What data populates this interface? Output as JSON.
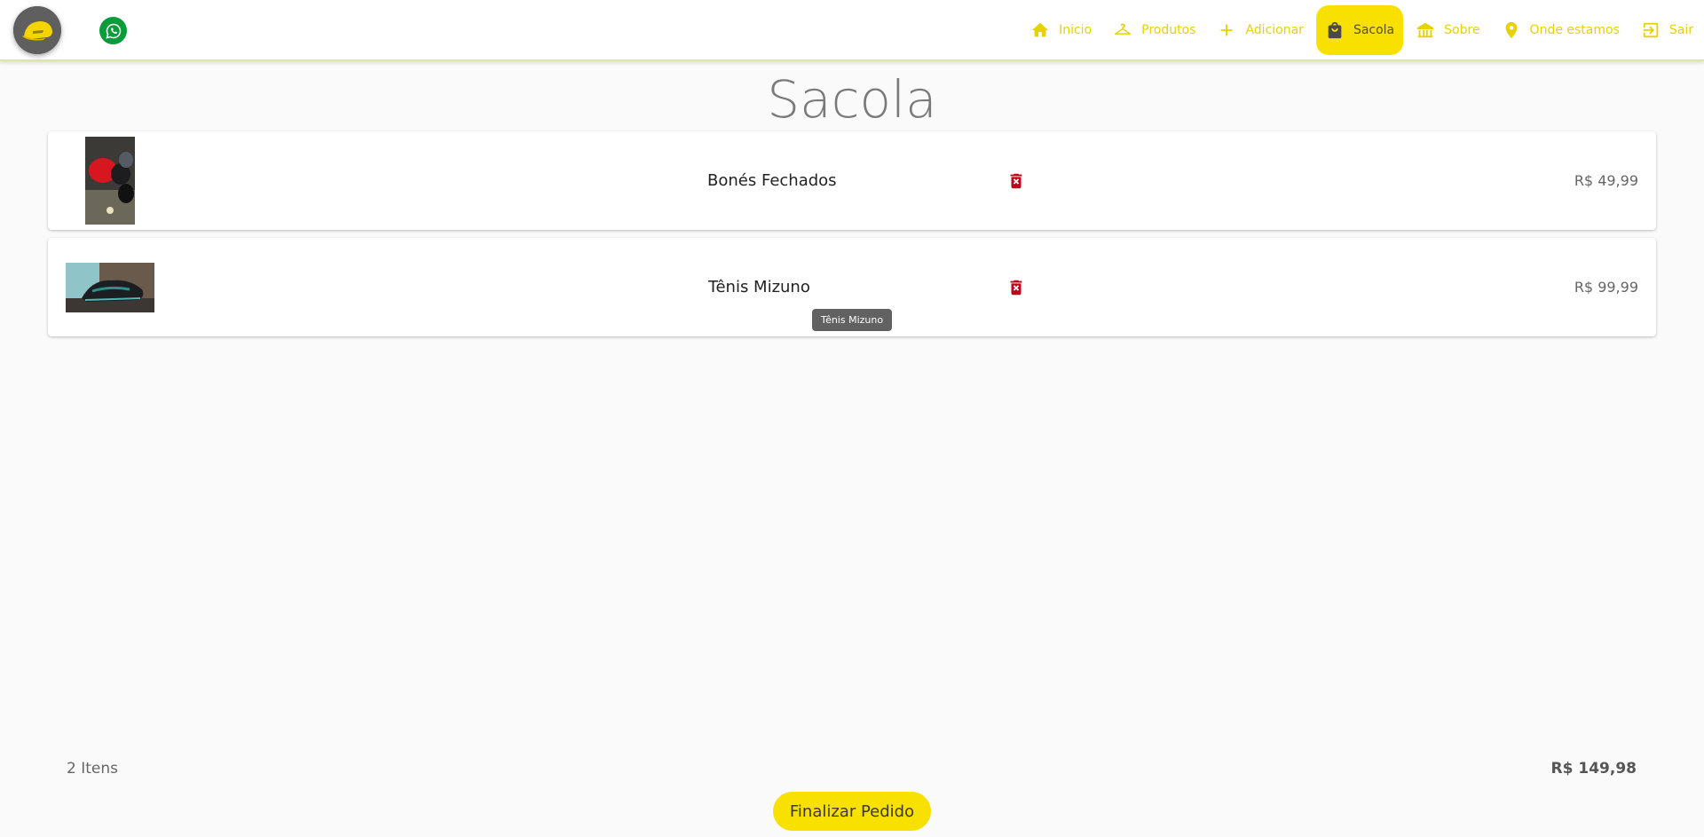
{
  "header": {
    "nav": [
      {
        "label": "Inicio",
        "icon": "home-icon"
      },
      {
        "label": "Produtos",
        "icon": "hanger-icon"
      },
      {
        "label": "Adicionar",
        "icon": "plus-icon"
      },
      {
        "label": "Sacola",
        "icon": "shopping-bag-icon",
        "active": true
      },
      {
        "label": "Sobre",
        "icon": "store-icon"
      },
      {
        "label": "Onde estamos",
        "icon": "location-pin-icon"
      },
      {
        "label": "Sair",
        "icon": "logout-icon"
      }
    ]
  },
  "page": {
    "title": "Sacola"
  },
  "cart": {
    "items": [
      {
        "name": "Bonés Fechados",
        "price": "R$ 49,99"
      },
      {
        "name": "Tênis Mizuno",
        "price": "R$ 99,99"
      }
    ],
    "tooltip": "Tênis Mizuno",
    "count_label": "2 Itens",
    "total": "R$ 149,98",
    "checkout_label": "Finalizar Pedido"
  },
  "colors": {
    "accent": "#f8e000",
    "nav_text": "#e6d200",
    "delete": "#c0001a",
    "whatsapp": "#0a9b3a"
  }
}
